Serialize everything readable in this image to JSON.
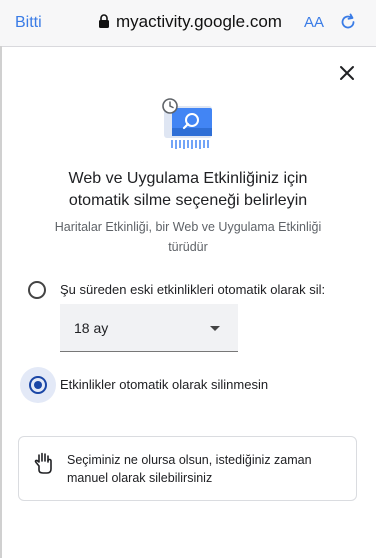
{
  "browser": {
    "done_label": "Bitti",
    "url": "myactivity.google.com",
    "text_size_label": "AA"
  },
  "dialog": {
    "title_line1": "Web ve Uygulama Etkinliğiniz için",
    "title_line2": "otomatik silme seçeneği belirleyin",
    "subtitle_line1": "Haritalar Etkinliği, bir Web ve Uygulama Etkinliği",
    "subtitle_line2": "türüdür",
    "option_auto_delete_label": "Şu süreden eski etkinlikleri otomatik olarak sil:",
    "duration_selected": "18 ay",
    "option_no_delete_label": "Etkinlikler otomatik olarak silinmesin",
    "selected_option": "no_delete",
    "note_line1": "Seçiminiz ne olursa olsun, istediğiniz zaman",
    "note_line2": "manuel olarak silebilirsiniz"
  },
  "colors": {
    "accent": "#1a46a6",
    "ios_blue": "#3a7ce6"
  }
}
